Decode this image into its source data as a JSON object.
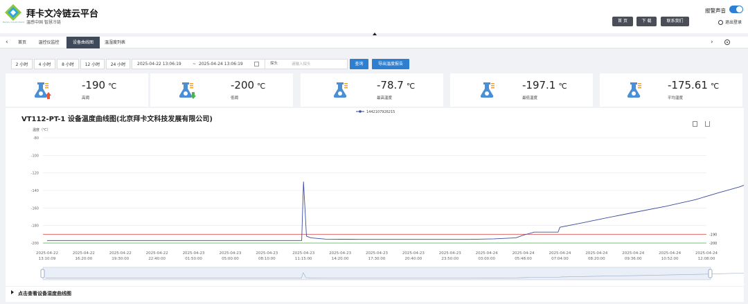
{
  "header": {
    "logo_text": "BAIKA COLDCHAIN",
    "title": "拜卡文冷链云平台",
    "subtitle": "温感中国 智慧冷链",
    "nav_buttons": [
      "首 页",
      "下 载",
      "联系我们"
    ],
    "alarm_sound_label": "报警声音",
    "alarm_sound_on": true,
    "logout_label": "退出登录"
  },
  "tabs": [
    {
      "label": "首页",
      "active": false
    },
    {
      "label": "温控仪监控",
      "active": false
    },
    {
      "label": "设备曲线图",
      "active": true
    },
    {
      "label": "温湿度列表",
      "active": false
    }
  ],
  "filters": {
    "hour_buttons": [
      "2 小时",
      "4 小时",
      "8 小时",
      "12 小时",
      "24 小时"
    ],
    "date_start": "2025-04-22 13:06:19",
    "date_sep": "~",
    "date_end": "2025-04-24 13:06:19",
    "probe_label": "探头",
    "probe_placeholder": "请输入探头",
    "query_button": "查询",
    "export_button": "导出温度报告"
  },
  "stats": [
    {
      "value": "-190",
      "unit": "℃",
      "label": "高阈",
      "icon": "thermometer-up-icon",
      "arrow_color": "#e8553e"
    },
    {
      "value": "-200",
      "unit": "℃",
      "label": "低阈",
      "icon": "thermometer-down-icon",
      "arrow_color": "#4caf50"
    },
    {
      "value": "-78.7",
      "unit": "℃",
      "label": "最高温度",
      "icon": "thermometer-icon"
    },
    {
      "value": "-197.1",
      "unit": "℃",
      "label": "最低温度",
      "icon": "thermometer-icon"
    },
    {
      "value": "-175.61",
      "unit": "℃",
      "label": "平均温度",
      "icon": "thermometer-icon"
    }
  ],
  "chart": {
    "title": "VT112-PT-1 设备温度曲线图(北京拜卡文科技发展有限公司)",
    "y_axis_label": "温度（℃）",
    "legend": "1442107926215",
    "tools": [
      "data-view-icon",
      "download-icon"
    ]
  },
  "bottom_link": "点击查看设备湿度曲线图",
  "chart_data": {
    "type": "line",
    "title": "VT112-PT-1 设备温度曲线图(北京拜卡文科技发展有限公司)",
    "ylabel": "温度（℃）",
    "xlabel": "",
    "ylim": [
      -200,
      -80
    ],
    "yticks": [
      -80,
      -100,
      -120,
      -140,
      -160,
      -180,
      -200
    ],
    "categories": [
      "2025-04-22 13:10:09",
      "2025-04-22 16:20:00",
      "2025-04-22 19:30:00",
      "2025-04-22 22:40:00",
      "2025-04-23 01:50:00",
      "2025-04-23 05:00:00",
      "2025-04-23 08:10:00",
      "2025-04-23 11:15:00",
      "2025-04-23 14:20:00",
      "2025-04-23 17:30:00",
      "2025-04-23 20:40:00",
      "2025-04-23 23:50:00",
      "2025-04-24 03:00:00",
      "2025-04-24 05:48:00",
      "2025-04-24 07:04:00",
      "2025-04-24 08:20:00",
      "2025-04-24 09:36:00",
      "2025-04-24 10:52:00",
      "2025-04-24 12:08:00"
    ],
    "series": [
      {
        "name": "1442107926215",
        "color": "#3b4a9e",
        "points": [
          [
            0,
            -197.1
          ],
          [
            6.95,
            -197.1
          ],
          [
            7.0,
            -130
          ],
          [
            7.08,
            -192
          ],
          [
            7.2,
            -194
          ],
          [
            7.6,
            -195.5
          ],
          [
            8.5,
            -195.8
          ],
          [
            11.5,
            -195.8
          ],
          [
            12.2,
            -195.2
          ],
          [
            12.8,
            -194
          ],
          [
            13.0,
            -191
          ],
          [
            13.3,
            -187.5
          ],
          [
            13.95,
            -187.5
          ],
          [
            14.0,
            -182
          ],
          [
            14.6,
            -177
          ],
          [
            15.3,
            -171
          ],
          [
            16.1,
            -164.5
          ],
          [
            16.9,
            -158
          ],
          [
            17.7,
            -150.5
          ],
          [
            18.3,
            -143
          ],
          [
            18.9,
            -136
          ],
          [
            19.32,
            -129.4
          ]
        ]
      }
    ],
    "thresholds": [
      {
        "name": "-190",
        "value": -190,
        "color": "#d9534f"
      },
      {
        "name": "-200",
        "value": -200,
        "color": "#4caf50"
      }
    ],
    "grid": true,
    "legend_position": "top-center",
    "data_zoom": true
  }
}
